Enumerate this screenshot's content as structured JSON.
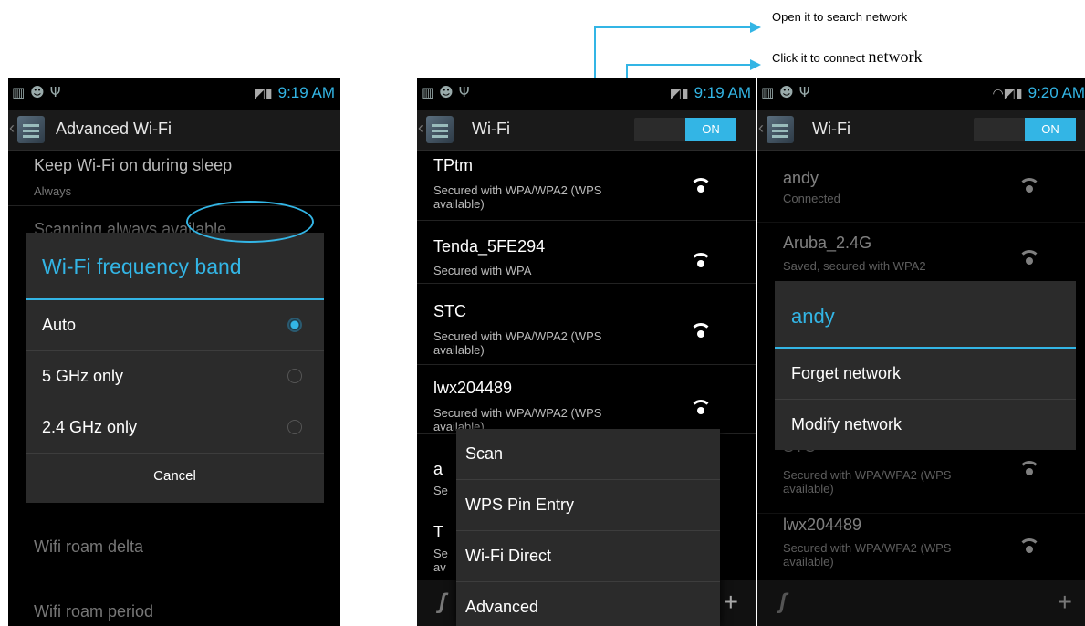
{
  "annotations": {
    "search": "Open it to search network",
    "connect_prefix": "Click it to connect ",
    "connect_word": "network"
  },
  "screen1": {
    "status_time": "9:19 AM",
    "title": "Advanced Wi-Fi",
    "keep_wifi_title": "Keep Wi-Fi on during sleep",
    "keep_wifi_value": "Always",
    "scanning_title": "Scanning always available",
    "dialog": {
      "title": "Wi-Fi frequency band",
      "options": [
        "Auto",
        "5 GHz only",
        "2.4 GHz only"
      ],
      "selected": "Auto",
      "cancel": "Cancel"
    },
    "roam_delta": "Wifi roam delta",
    "roam_period": "Wifi roam period"
  },
  "screen2": {
    "status_time": "9:19 AM",
    "title": "Wi-Fi",
    "toggle": "ON",
    "networks": [
      {
        "ssid": "TPtm",
        "sub": "Secured with WPA/WPA2 (WPS available)"
      },
      {
        "ssid": "Tenda_5FE294",
        "sub": "Secured with WPA"
      },
      {
        "ssid": "STC",
        "sub": "Secured with WPA/WPA2 (WPS available)"
      },
      {
        "ssid": "lwx204489",
        "sub": "Secured with WPA/WPA2 (WPS available)"
      },
      {
        "ssid": "a",
        "sub": "Se"
      },
      {
        "ssid": "T",
        "sub": "Se av"
      }
    ],
    "menu": [
      "Scan",
      "WPS Pin Entry",
      "Wi-Fi Direct",
      "Advanced"
    ]
  },
  "screen3": {
    "status_time": "9:20 AM",
    "title": "Wi-Fi",
    "toggle": "ON",
    "networks": [
      {
        "ssid": "andy",
        "sub": "Connected"
      },
      {
        "ssid": "Aruba_2.4G",
        "sub": "Saved, secured with WPA2"
      },
      {
        "ssid": "STC",
        "sub": "Secured with WPA/WPA2 (WPS available)"
      },
      {
        "ssid": "lwx204489",
        "sub": "Secured with WPA/WPA2 (WPS available)"
      }
    ],
    "dialog": {
      "title": "andy",
      "items": [
        "Forget network",
        "Modify network"
      ]
    }
  },
  "colors": {
    "accent": "#33b5e5",
    "background": "#000000"
  }
}
